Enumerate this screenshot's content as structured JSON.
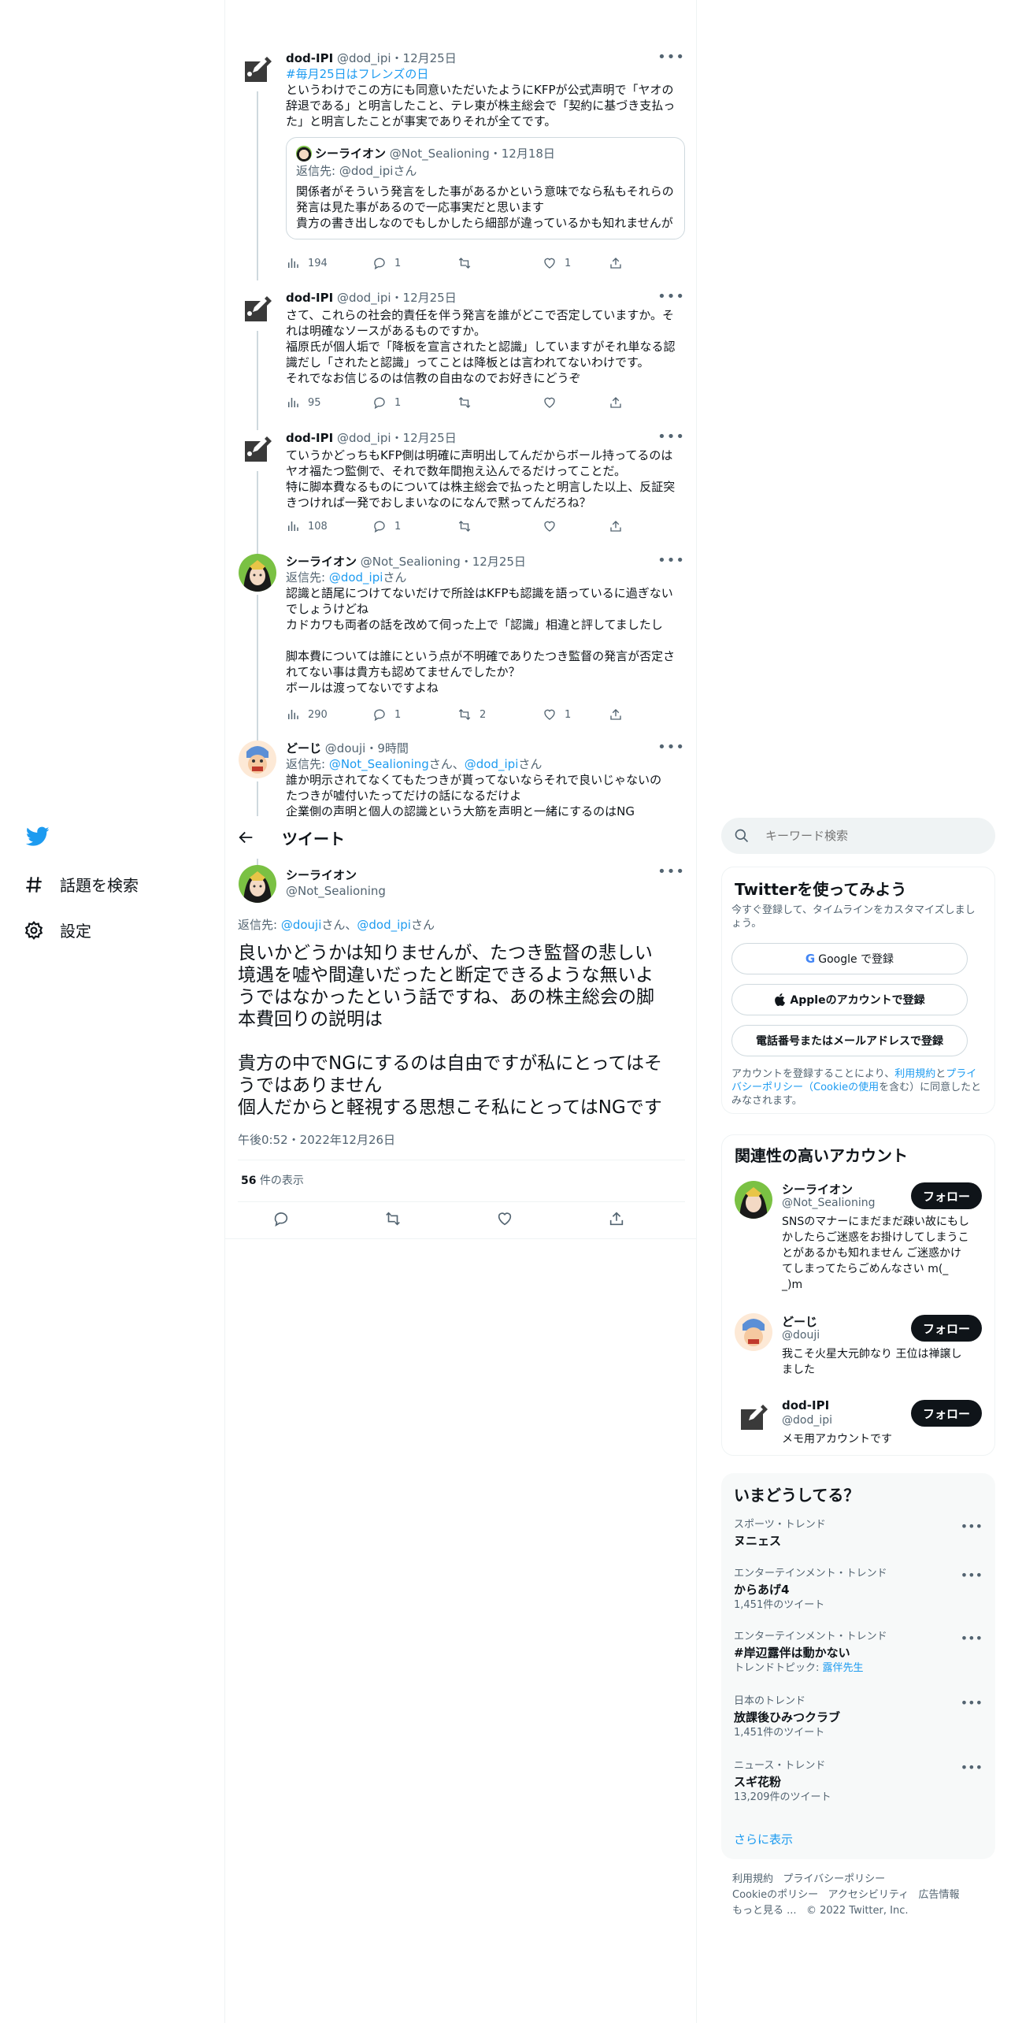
{
  "nav": {
    "explore_label": "話題を検索",
    "settings_label": "設定"
  },
  "thread": [
    {
      "name": "dod-IPI",
      "handle": "@dod_ipi",
      "date": "12月25日",
      "hashtag": "#毎月25日はフレンズの日",
      "text": "というわけでこの方にも同意いただいたようにKFPが公式声明で「ヤオの\n辞退である」と明言したこと、テレ東が株主総会で「契約に基づき支払っ\nた」と明言したことが事実でありそれが全てです。",
      "quote": {
        "name": "シーライオン",
        "handle": "@Not_Sealioning",
        "date": "12月18日",
        "reply_prefix": "返信先: ",
        "reply_to": "@dod_ipi",
        "reply_suffix": "さん",
        "text": "関係者がそういう発言をした事があるかという意味でなら私もそれらの\n発言は見た事があるので一応事実だと思います\n貴方の書き出しなのでもしかしたら細部が違っているかも知れませんが"
      },
      "views": "194",
      "replies": "1",
      "retweets": "",
      "likes": "1"
    },
    {
      "name": "dod-IPI",
      "handle": "@dod_ipi",
      "date": "12月25日",
      "text": "さて、これらの社会的責任を伴う発言を誰がどこで否定していますか。そ\nれは明確なソースがあるものですか。\n福原氏が個人垢で「降板を宣言されたと認識」していますがそれ単なる認\n識だし「されたと認識」ってことは降板とは言われてないわけです。\nそれでなお信じるのは信教の自由なのでお好きにどうぞ",
      "views": "95",
      "replies": "1",
      "retweets": "",
      "likes": ""
    },
    {
      "name": "dod-IPI",
      "handle": "@dod_ipi",
      "date": "12月25日",
      "text": "ていうかどっちもKFP側は明確に声明出してんだからボール持ってるのは\nヤオ福たつ監側で、それで数年間抱え込んでるだけってことだ。\n特に脚本費なるものについては株主総会で払ったと明言した以上、反証突\nきつければ一発でおしまいなのになんで黙ってんだろね？",
      "views": "108",
      "replies": "1",
      "retweets": "",
      "likes": ""
    },
    {
      "name": "シーライオン",
      "handle": "@Not_Sealioning",
      "date": "12月25日",
      "reply_prefix": "返信先: ",
      "reply_to": "@dod_ipi",
      "reply_suffix": "さん",
      "text": "認識と語尾につけてないだけで所詮はKFPも認識を語っているに過ぎない\nでしょうけどね\nカドカワも両者の話を改めて伺った上で「認識」相違と評してましたし\n\n脚本費については誰にという点が不明確でありたつき監督の発言が否定さ\nれてない事は貴方も認めてませんでしたか？\nボールは渡ってないですよね",
      "views": "290",
      "replies": "1",
      "retweets": "2",
      "likes": "1"
    },
    {
      "name": "どーじ",
      "handle": "@douji",
      "date": "9時間",
      "reply_prefix": "返信先: ",
      "reply_to": "@Not_Sealioning",
      "reply_mid": "さん、",
      "reply_to2": "@dod_ipi",
      "reply_suffix": "さん",
      "text": "誰か明示されてなくてもたつきが貰ってないならそれで良いじゃないの\nたつきが嘘付いたってだけの話になるだけよ\n企業側の声明と個人の認識という大筋を声明と一緒にするのはNG"
    }
  ],
  "main_header": {
    "title": "ツイート"
  },
  "main_tweet": {
    "name": "シーライオン",
    "handle": "@Not_Sealioning",
    "reply_prefix": "返信先: ",
    "reply_to": "@douji",
    "reply_mid": "さん、",
    "reply_to2": "@dod_ipi",
    "reply_suffix": "さん",
    "text": "良いかどうかは知りませんが、たつき監督の悲しい\n境遇を嘘や間違いだったと断定できるような無いよ\nうではなかったという話ですね、あの株主総会の脚\n本費回りの説明は\n\n貴方の中でNGにするのは自由ですが私にとってはそ\nうではありません\n個人だからと軽視する思想こそ私にとってはNGです",
    "timestamp": "午後0:52・2022年12月26日",
    "views_count": "56",
    "views_label": " 件の表示"
  },
  "search": {
    "placeholder": "キーワード検索"
  },
  "signup": {
    "title": "Twitterを使ってみよう",
    "subtitle": "今すぐ登録して、タイムラインをカスタマイズしましょう。",
    "google_label": "Google で登録",
    "apple_label": "Appleのアカウントで登録",
    "phone_label": "電話番号またはメールアドレスで登録",
    "terms_pre": "アカウントを登録することにより、",
    "terms_link1": "利用規約",
    "terms_mid": "と",
    "terms_link2": "プライバシーポリシー（Cookieの使用",
    "terms_post": "を含む）に同意したとみなされます。"
  },
  "relevant": {
    "title": "関連性の高いアカウント",
    "follow_label": "フォロー",
    "accounts": [
      {
        "name": "シーライオン",
        "handle": "@Not_Sealioning",
        "bio": "SNSのマナーにまだまだ疎い故にもし\nかしたらご迷惑をお掛けしてしまうこ\nとがあるかも知れません ご迷惑かけ\nてしまってたらごめんなさい m(_\n_)m"
      },
      {
        "name": "どーじ",
        "handle": "@douji",
        "bio": "我こそ火星大元帥なり 王位は禅譲し\nました"
      },
      {
        "name": "dod-IPI",
        "handle": "@dod_ipi",
        "bio": "メモ用アカウントです"
      }
    ]
  },
  "trends": {
    "title": "いまどうしてる？",
    "items": [
      {
        "category": "スポーツ・トレンド",
        "name": "ヌニェス",
        "sub": ""
      },
      {
        "category": "エンターテインメント・トレンド",
        "name": "からあげ4",
        "sub": "1,451件のツイート"
      },
      {
        "category": "エンターテインメント・トレンド",
        "name": "#岸辺露伴は動かない",
        "sub_pre": "トレンドトピック: ",
        "sub_link": "露伴先生"
      },
      {
        "category": "日本のトレンド",
        "name": "放課後ひみつクラブ",
        "sub": "1,451件のツイート"
      },
      {
        "category": "ニュース・トレンド",
        "name": "スギ花粉",
        "sub": "13,209件のツイート"
      }
    ],
    "show_more": "さらに表示"
  },
  "footer": {
    "links": [
      "利用規約",
      "プライバシーポリシー",
      "Cookieのポリシー",
      "アクセシビリティ",
      "広告情報",
      "もっと見る ..."
    ],
    "copyright": "© 2022 Twitter, Inc."
  },
  "colors": {
    "accent": "#1d9bf0",
    "text": "#0f1419",
    "muted": "#536471",
    "panel": "#f7f9f9"
  }
}
